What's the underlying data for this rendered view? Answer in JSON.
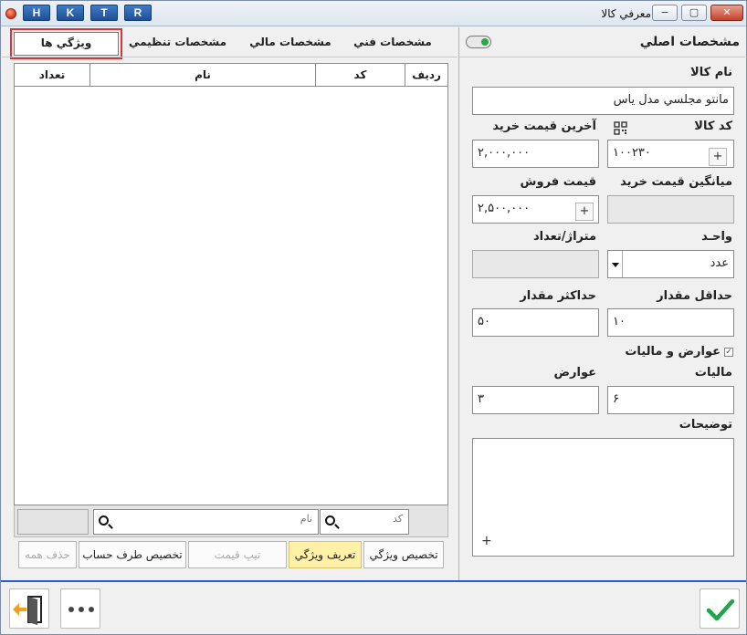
{
  "window": {
    "title": "معرفي کالا",
    "hotkeys": [
      "H",
      "K",
      "T",
      "R"
    ],
    "buttons": {
      "minimize": "−",
      "restore": "▢",
      "close": "✕"
    }
  },
  "main_section": {
    "title": "مشخصات اصلي",
    "toggle_on": true,
    "fields": {
      "name_label": "نام کالا",
      "name_value": "مانتو مجلسي مدل ياس",
      "code_label": "کد کالا",
      "code_value": "۱۰۰۲۳۰",
      "last_price_label": "آخرين قيمت خريد",
      "last_price_value": "۲,۰۰۰,۰۰۰",
      "avg_price_label": "ميانگين قيمت خريد",
      "avg_price_value": "",
      "sale_price_label": "قيمت فروش",
      "sale_price_value": "۲,۵۰۰,۰۰۰",
      "unit_label": "واحـد",
      "unit_value": "عدد",
      "meter_label": "متراژ/تعداد",
      "meter_value": "",
      "min_label": "حداقل مقدار",
      "min_value": "۱۰",
      "max_label": "حداکثر مقدار",
      "max_value": "۵۰",
      "tax_check_label": "عوارض و ماليات",
      "tax_checked": true,
      "tax_label": "ماليات",
      "tax_value": "۶",
      "duty_label": "عوارض",
      "duty_value": "۳",
      "desc_label": "توضيحات",
      "desc_value": "",
      "plus": "+"
    }
  },
  "tabs": [
    {
      "label": "مشخصات فني",
      "active": false
    },
    {
      "label": "مشخصات مالي",
      "active": false
    },
    {
      "label": "مشخصات تنظيمي",
      "active": false
    },
    {
      "label": "ويژگي ها",
      "active": true
    }
  ],
  "grid": {
    "columns": [
      "رديف",
      "کد",
      "نام",
      "تعداد"
    ],
    "rows": []
  },
  "search": {
    "code_placeholder": "کد",
    "name_placeholder": "نام"
  },
  "actions": [
    {
      "label": "تخصيص ويژگي",
      "state": "normal"
    },
    {
      "label": "تعريف ويژگي",
      "state": "highlight"
    },
    {
      "label": "تيپ قيمت",
      "state": "dim"
    },
    {
      "label": "تخصيص طرف حساب",
      "state": "normal"
    },
    {
      "label": "حذف همه",
      "state": "dim"
    }
  ],
  "footer": {
    "exit_icon": "exit-door-icon",
    "more_icon": "more-dots-icon",
    "confirm_icon": "check-icon",
    "accent": "#2a5bd7",
    "confirm_color": "#1fa64a"
  }
}
